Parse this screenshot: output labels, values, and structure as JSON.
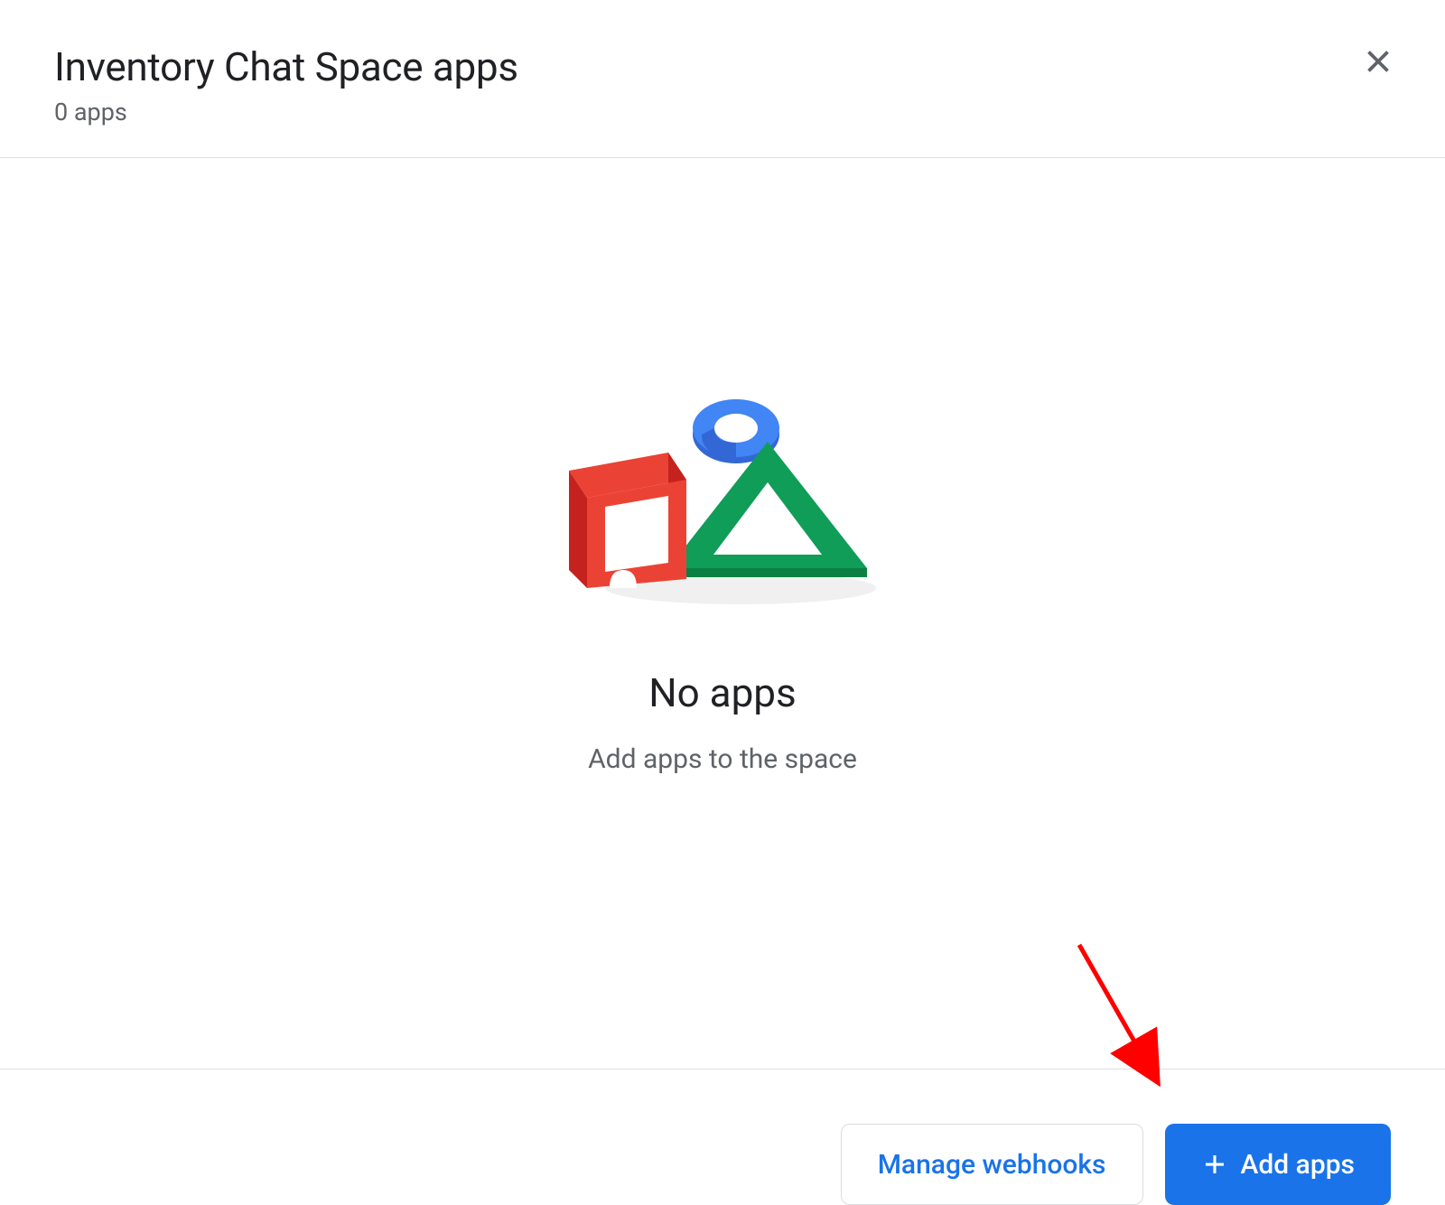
{
  "header": {
    "title": "Inventory Chat Space apps",
    "subtitle": "0 apps"
  },
  "empty_state": {
    "title": "No apps",
    "subtitle": "Add apps to the space"
  },
  "footer": {
    "manage_webhooks_label": "Manage webhooks",
    "add_apps_label": "Add apps"
  },
  "colors": {
    "primary_blue": "#1a73e8",
    "text_primary": "#202124",
    "text_secondary": "#5f6368",
    "border": "#e0e0e0",
    "illustration_red": "#ea4335",
    "illustration_green": "#0f9d58",
    "illustration_blue": "#4285f4"
  }
}
